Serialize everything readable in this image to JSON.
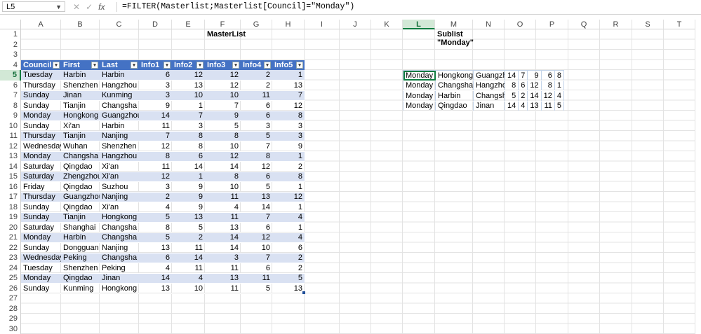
{
  "formula_bar": {
    "name_box": "L5",
    "formula": "=FILTER(Masterlist;Masterlist[Council]=\"Monday\")",
    "cancel_icon": "✕",
    "enter_icon": "✓",
    "fx_icon": "fx"
  },
  "columns": [
    "A",
    "B",
    "C",
    "D",
    "E",
    "F",
    "G",
    "H",
    "I",
    "J",
    "K",
    "L",
    "M",
    "N",
    "O",
    "P",
    "Q",
    "R",
    "S",
    "T"
  ],
  "rows": [
    "1",
    "2",
    "3",
    "4",
    "5",
    "6",
    "7",
    "8",
    "9",
    "10",
    "11",
    "12",
    "13",
    "14",
    "15",
    "16",
    "17",
    "18",
    "19",
    "20",
    "21",
    "22",
    "23",
    "24",
    "25",
    "26",
    "27",
    "28",
    "29",
    "30"
  ],
  "selected_column": "L",
  "selected_row": "5",
  "masterlist": {
    "title": "MasterList",
    "headers": [
      "Council",
      "First",
      "Last",
      "Info1",
      "Info2",
      "Info3",
      "Info4",
      "Info5"
    ],
    "rows": [
      [
        "Tuesday",
        "Harbin",
        "Harbin",
        "6",
        "12",
        "12",
        "2",
        "1"
      ],
      [
        "Thursday",
        "Shenzhen",
        "Hangzhou",
        "3",
        "13",
        "12",
        "2",
        "13"
      ],
      [
        "Sunday",
        "Jinan",
        "Kunming",
        "3",
        "10",
        "10",
        "11",
        "7"
      ],
      [
        "Sunday",
        "Tianjin",
        "Changsha",
        "9",
        "1",
        "7",
        "6",
        "12"
      ],
      [
        "Monday",
        "Hongkong",
        "Guangzhou",
        "14",
        "7",
        "9",
        "6",
        "8"
      ],
      [
        "Sunday",
        "Xi'an",
        "Harbin",
        "11",
        "3",
        "5",
        "3",
        "3"
      ],
      [
        "Thursday",
        "Tianjin",
        "Nanjing",
        "7",
        "8",
        "8",
        "5",
        "3"
      ],
      [
        "Wednesday",
        "Wuhan",
        "Shenzhen",
        "12",
        "8",
        "10",
        "7",
        "9"
      ],
      [
        "Monday",
        "Changsha",
        "Hangzhou",
        "8",
        "6",
        "12",
        "8",
        "1"
      ],
      [
        "Saturday",
        "Qingdao",
        "Xi'an",
        "11",
        "14",
        "14",
        "12",
        "2"
      ],
      [
        "Saturday",
        "Zhengzhou",
        "Xi'an",
        "12",
        "1",
        "8",
        "6",
        "8"
      ],
      [
        "Friday",
        "Qingdao",
        "Suzhou",
        "3",
        "9",
        "10",
        "5",
        "1"
      ],
      [
        "Thursday",
        "Guangzhou",
        "Nanjing",
        "2",
        "9",
        "11",
        "13",
        "12"
      ],
      [
        "Sunday",
        "Qingdao",
        "Xi'an",
        "4",
        "9",
        "4",
        "14",
        "1"
      ],
      [
        "Sunday",
        "Tianjin",
        "Hongkong",
        "5",
        "13",
        "11",
        "7",
        "4"
      ],
      [
        "Saturday",
        "Shanghai",
        "Changsha",
        "8",
        "5",
        "13",
        "6",
        "1"
      ],
      [
        "Monday",
        "Harbin",
        "Changsha",
        "5",
        "2",
        "14",
        "12",
        "4"
      ],
      [
        "Sunday",
        "Dongguan",
        "Nanjing",
        "13",
        "11",
        "14",
        "10",
        "6"
      ],
      [
        "Wednesday",
        "Peking",
        "Changsha",
        "6",
        "14",
        "3",
        "7",
        "2"
      ],
      [
        "Tuesday",
        "Shenzhen",
        "Peking",
        "4",
        "11",
        "11",
        "6",
        "2"
      ],
      [
        "Monday",
        "Qingdao",
        "Jinan",
        "14",
        "4",
        "13",
        "11",
        "5"
      ],
      [
        "Sunday",
        "Kunming",
        "Hongkong",
        "13",
        "10",
        "11",
        "5",
        "13"
      ]
    ]
  },
  "sublist": {
    "title": "Sublist \"Monday\"",
    "rows": [
      [
        "Monday",
        "Hongkong",
        "Guangzhou",
        "14",
        "7",
        "9",
        "6",
        "8"
      ],
      [
        "Monday",
        "Changsha",
        "Hangzhou",
        "8",
        "6",
        "12",
        "8",
        "1"
      ],
      [
        "Monday",
        "Harbin",
        "Changsha",
        "5",
        "2",
        "14",
        "12",
        "4"
      ],
      [
        "Monday",
        "Qingdao",
        "Jinan",
        "14",
        "4",
        "13",
        "11",
        "5"
      ]
    ]
  }
}
